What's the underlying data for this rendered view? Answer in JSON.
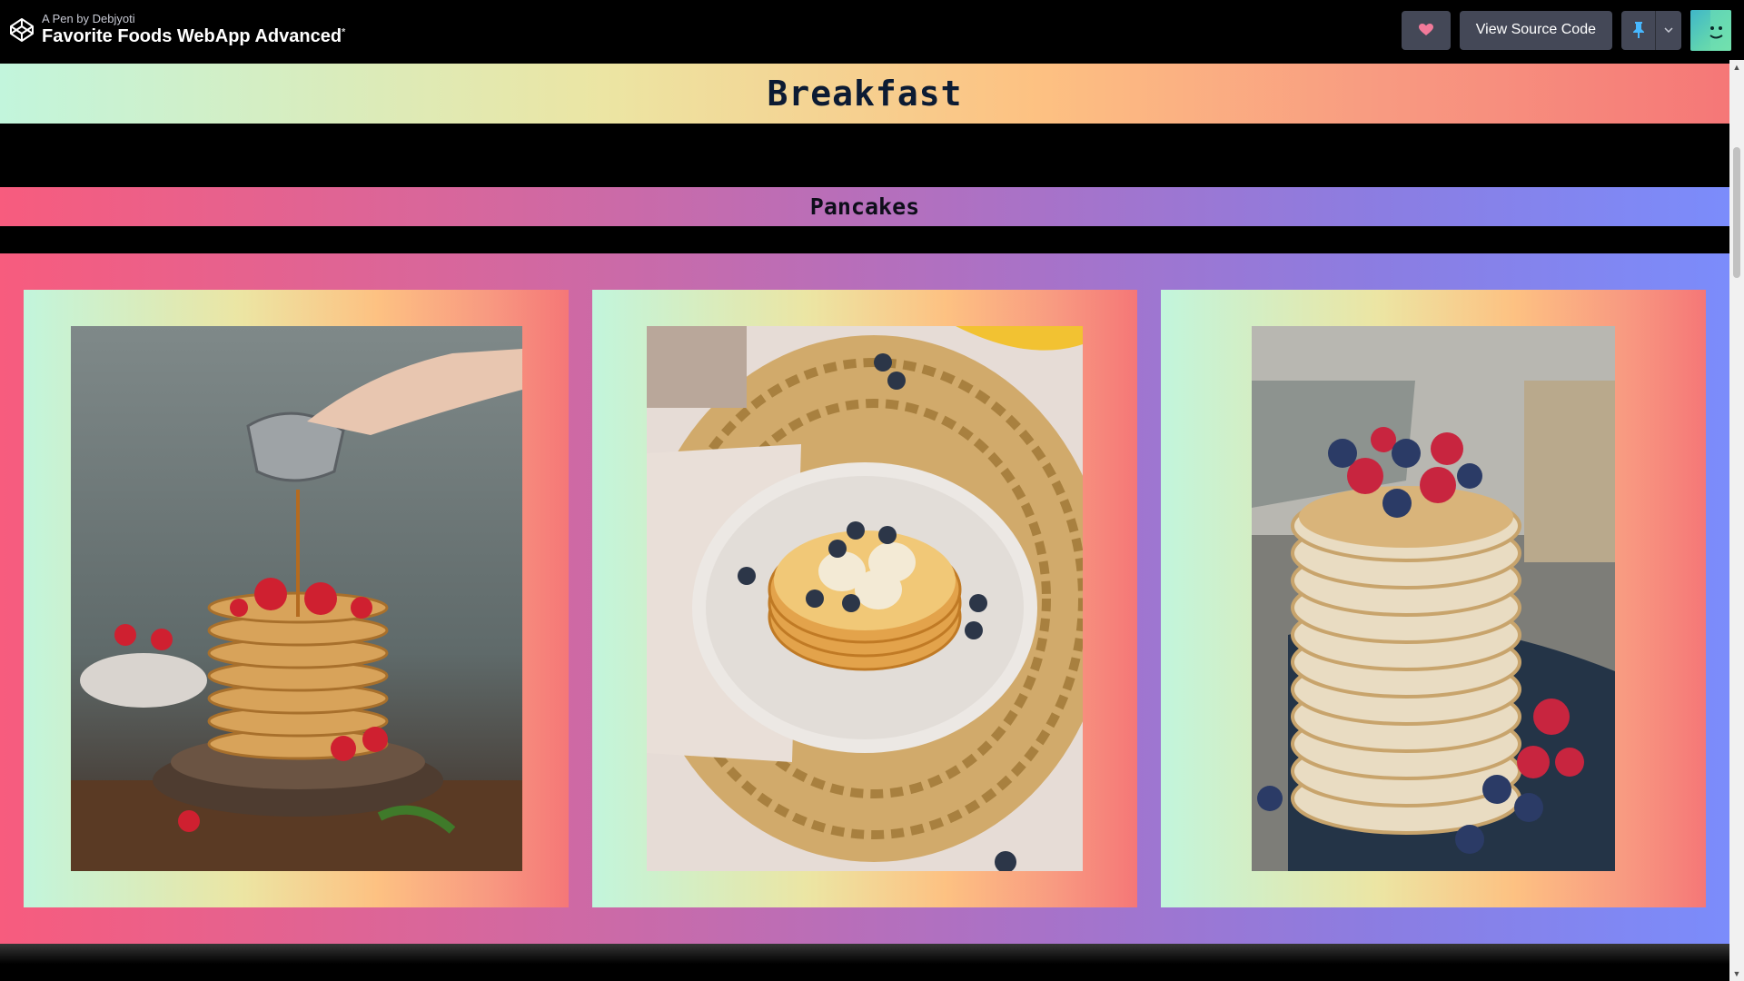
{
  "header": {
    "byline": "A Pen by Debjyoti",
    "title": "Favorite Foods WebApp Advanced",
    "unsaved_marker": "*",
    "view_source_label": "View Source Code"
  },
  "page": {
    "section_title": "Breakfast",
    "food_title": "Pancakes"
  },
  "icons": {
    "logo": "codepen-logo-icon",
    "heart": "heart-icon",
    "pin": "pin-icon",
    "chevron": "chevron-down-icon",
    "avatar": "user-avatar"
  },
  "colors": {
    "heart": "#f27a9a",
    "pin": "#47cf73",
    "breakfast_text": "#0c1b33"
  }
}
